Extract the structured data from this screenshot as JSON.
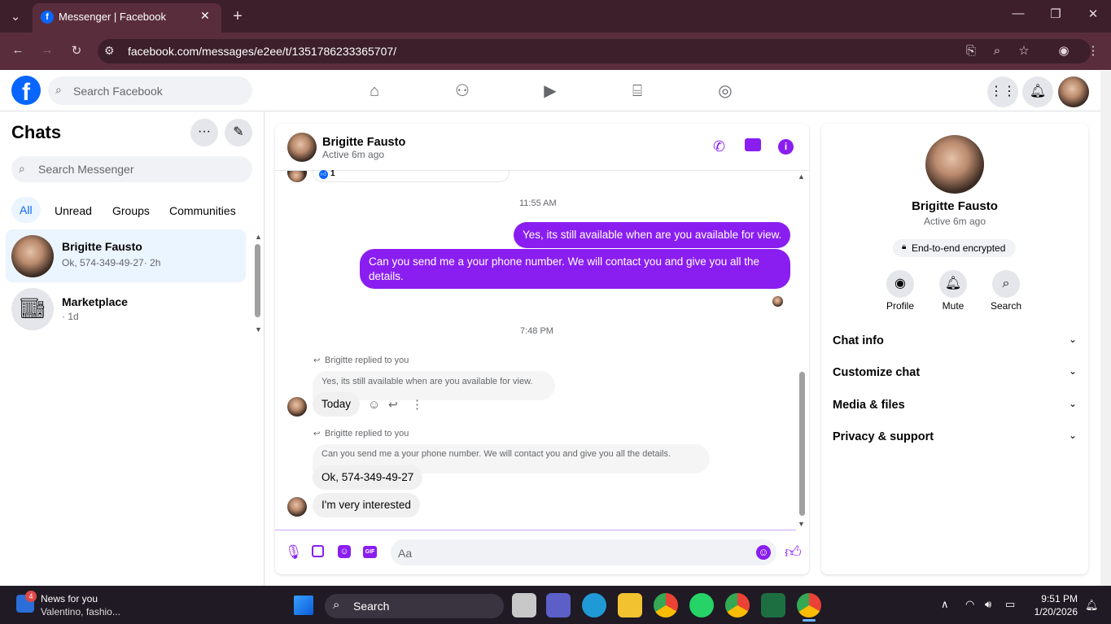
{
  "browser": {
    "tab_title": "Messenger | Facebook",
    "url": "facebook.com/messages/e2ee/t/1351786233365707/"
  },
  "fb": {
    "logo": "f",
    "search_placeholder": "Search Facebook"
  },
  "left": {
    "title": "Chats",
    "search_placeholder": "Search Messenger",
    "filters": [
      "All",
      "Unread",
      "Groups",
      "Communities"
    ],
    "chats": [
      {
        "name": "Brigitte Fausto",
        "preview": "Ok, 574-349-49-27· 2h"
      },
      {
        "name": "Marketplace",
        "preview": "· 1d"
      }
    ]
  },
  "conversation": {
    "name": "Brigitte Fausto",
    "status": "Active 6m ago",
    "reaction_count": "1",
    "ts1": "11:55 AM",
    "msg_out1": "Yes, its still available when are you available for view.",
    "msg_out2": "Can you send me a your phone number. We will contact you and give you all the details.",
    "ts2": "7:48 PM",
    "reply1_label": "Brigitte replied to you",
    "reply1_quote": "Yes, its still available when are you available for view.",
    "reply1_msg": "Today",
    "reply2_label": "Brigitte replied to you",
    "reply2_quote": "Can you send me a your phone number. We will contact you and give you all the details.",
    "reply2_msg": "Ok, 574-349-49-27",
    "msg_in3": "I'm very interested",
    "composer_placeholder": "Aa"
  },
  "right": {
    "name": "Brigitte Fausto",
    "status": "Active 6m ago",
    "e2e": "End-to-end encrypted",
    "actions": [
      "Profile",
      "Mute",
      "Search"
    ],
    "sections": [
      "Chat info",
      "Customize chat",
      "Media & files",
      "Privacy & support"
    ]
  },
  "taskbar": {
    "news_title": "News for you",
    "news_sub": "Valentino, fashio...",
    "news_badge": "4",
    "search": "Search",
    "time": "9:51 PM",
    "date": "1/20/2026"
  },
  "colors": {
    "accent": "#8a1ef0",
    "fb_blue": "#0866ff",
    "chrome": "#5a2d3d"
  }
}
